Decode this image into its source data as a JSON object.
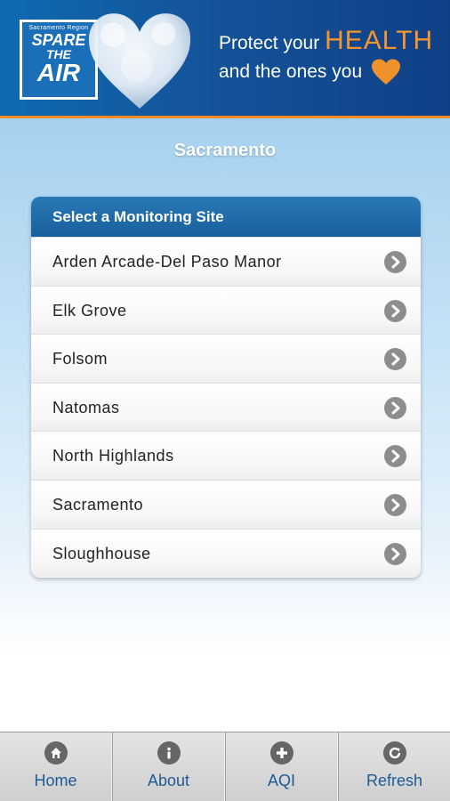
{
  "header": {
    "logo": {
      "region": "Sacramento Region",
      "word1": "SPARE",
      "word2": "THE",
      "word3": "AIR"
    },
    "tagline_line1": "Protect your",
    "tagline_highlight": "HEALTH",
    "tagline_line2": "and the ones you"
  },
  "page_title": "Sacramento",
  "site_list": {
    "header": "Select a Monitoring Site",
    "items": [
      {
        "label": "Arden Arcade-Del Paso Manor"
      },
      {
        "label": "Elk Grove"
      },
      {
        "label": "Folsom"
      },
      {
        "label": "Natomas"
      },
      {
        "label": "North Highlands"
      },
      {
        "label": "Sacramento"
      },
      {
        "label": "Sloughhouse"
      }
    ]
  },
  "tabbar": {
    "tabs": [
      {
        "label": "Home",
        "icon": "home-icon"
      },
      {
        "label": "About",
        "icon": "info-icon"
      },
      {
        "label": "AQI",
        "icon": "plus-icon"
      },
      {
        "label": "Refresh",
        "icon": "refresh-icon"
      }
    ]
  },
  "colors": {
    "banner": "#14549a",
    "accent_orange": "#f08a24",
    "list_header": "#1c66a4",
    "tab_label": "#1f5a96"
  }
}
